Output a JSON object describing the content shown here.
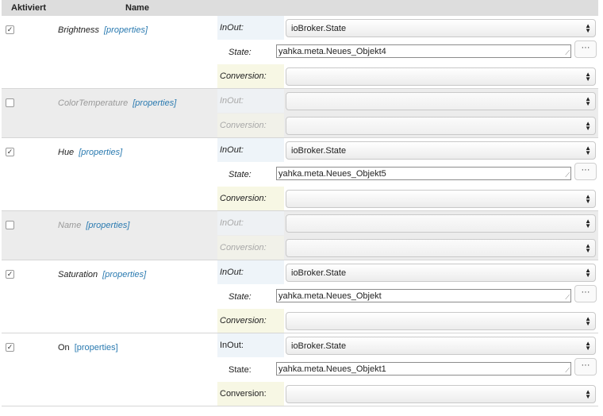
{
  "header": {
    "col_active": "Aktiviert",
    "col_name": "Name"
  },
  "labels": {
    "properties": "[properties]",
    "inout": "InOut:",
    "state": "State:",
    "conversion": "Conversion:",
    "browse": "···"
  },
  "rows": [
    {
      "name": "Brightness",
      "active": true,
      "inout": "ioBroker.State",
      "state": "yahka.meta.Neues_Objekt4",
      "conversion": ""
    },
    {
      "name": "ColorTemperature",
      "active": false,
      "inout": "",
      "conversion": ""
    },
    {
      "name": "Hue",
      "active": true,
      "inout": "ioBroker.State",
      "state": "yahka.meta.Neues_Objekt5",
      "conversion": ""
    },
    {
      "name": "Name",
      "active": false,
      "inout": "",
      "conversion": ""
    },
    {
      "name": "Saturation",
      "active": true,
      "inout": "ioBroker.State",
      "state": "yahka.meta.Neues_Objekt",
      "conversion": ""
    },
    {
      "name": "On",
      "active": true,
      "inout": "ioBroker.State",
      "state": "yahka.meta.Neues_Objekt1",
      "conversion": ""
    }
  ]
}
